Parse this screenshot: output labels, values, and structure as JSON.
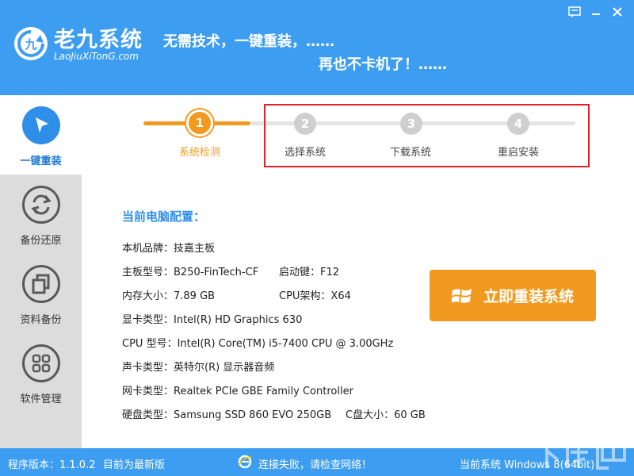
{
  "app": {
    "name": "老九系统",
    "url": "LaoJiuXiTonG.com",
    "slogan_line1": "无需技术，一键重装，……",
    "slogan_line2": "再也不卡机了！……"
  },
  "window_controls": [
    "message-icon",
    "minimize-icon",
    "close-icon"
  ],
  "sidebar": {
    "items": [
      {
        "label": "一键重装",
        "icon": "cursor-arrow-icon",
        "active": true
      },
      {
        "label": "备份还原",
        "icon": "refresh-cycle-icon",
        "active": false
      },
      {
        "label": "资料备份",
        "icon": "copy-icon",
        "active": false
      },
      {
        "label": "软件管理",
        "icon": "grid-icon",
        "active": false
      }
    ]
  },
  "steps": [
    {
      "number": "1",
      "label": "系统检测",
      "active": true
    },
    {
      "number": "2",
      "label": "选择系统",
      "active": false
    },
    {
      "number": "3",
      "label": "下载系统",
      "active": false
    },
    {
      "number": "4",
      "label": "重启安装",
      "active": false
    }
  ],
  "config": {
    "title": "当前电脑配置：",
    "brand": "本机品牌：技嘉主板",
    "board": "主板型号：B250-FinTech-CF",
    "hotkey": "启动键：F12",
    "memory": "内存大小：7.89 GB",
    "cpu_arch": "CPU架构：X64",
    "gpu": "显卡类型：Intel(R) HD Graphics 630",
    "cpu": "CPU 型号：Intel(R) Core(TM) i5-7400 CPU @ 3.00GHz",
    "sound": "声卡类型：英特尔(R) 显示器音频",
    "nic": "网卡类型：Realtek PCIe GBE Family Controller",
    "disk": "硬盘类型：Samsung SSD 860 EVO 250GB",
    "c_drive": "C盘大小：60 GB"
  },
  "reinstall_button": {
    "label": "立即重装系统",
    "icon": "windows-logo-icon"
  },
  "statusbar": {
    "version": "程序版本：1.1.0.2",
    "update_status": "目前为最新版",
    "network": "连接失败，请检查网络！",
    "current_system": "当前系统 Windows 8(64bit)"
  },
  "colors": {
    "header_blue": "#3d9df0",
    "accent_blue": "#2f8fe8",
    "orange": "#f29a1f",
    "highlight_red": "#e0202b",
    "sidebar_gray": "#dcdcdc"
  }
}
